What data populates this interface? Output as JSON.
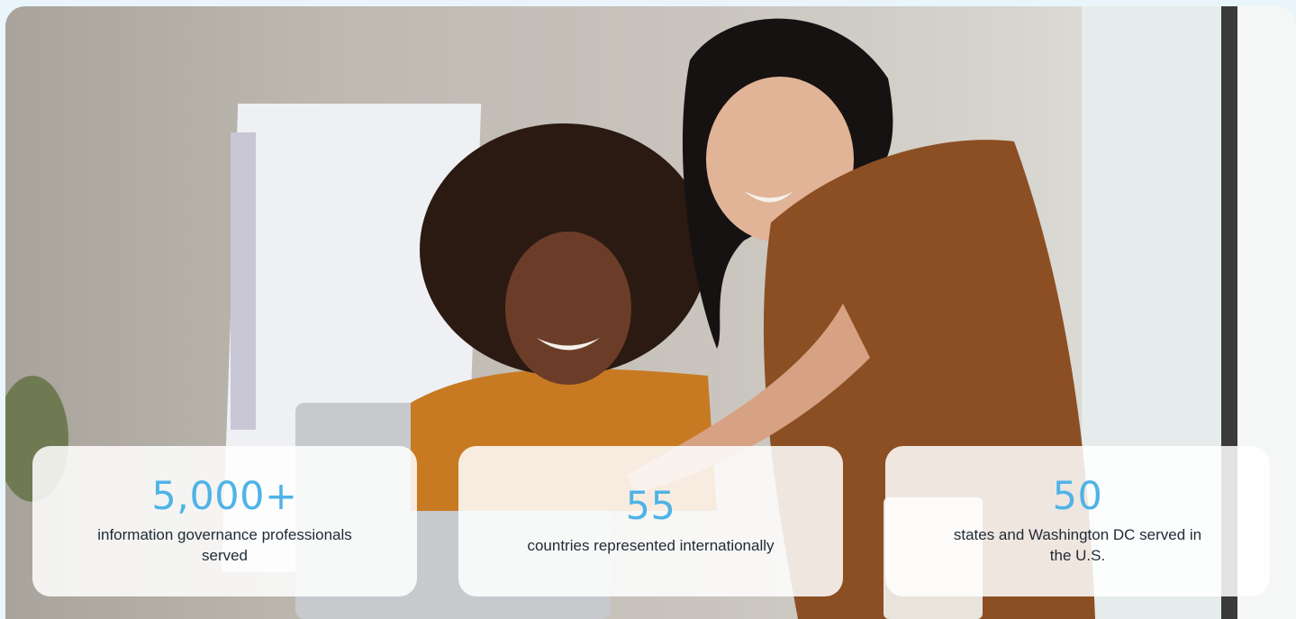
{
  "hero": {
    "image": "office-coworkers-photo"
  },
  "stats": [
    {
      "value": "5,000+",
      "label": "information governance professionals served"
    },
    {
      "value": "55",
      "label": "countries represented internationally"
    },
    {
      "value": "50",
      "label": "states and Washington DC served in the U.S."
    }
  ],
  "colors": {
    "accent": "#4fb3e6",
    "text": "#1f2a33",
    "background": "#e9f5fb"
  }
}
